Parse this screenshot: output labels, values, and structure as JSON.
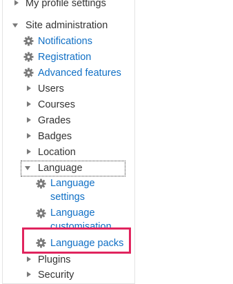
{
  "nav": {
    "my_profile_settings": "My profile settings",
    "site_administration": "Site administration",
    "notifications": "Notifications",
    "registration": "Registration",
    "advanced_features": "Advanced features",
    "users": "Users",
    "courses": "Courses",
    "grades": "Grades",
    "badges": "Badges",
    "location": "Location",
    "language": "Language",
    "language_settings_line1": "Language",
    "language_settings_line2": "settings",
    "language_customisation_line1": "Language",
    "language_customisation_line2": "customisation",
    "language_packs": "Language packs",
    "plugins": "Plugins",
    "security": "Security"
  },
  "icons": {
    "collapsed": "triangle-right-icon",
    "expanded": "triangle-down-icon",
    "settings": "gear-icon"
  },
  "colors": {
    "link": "#0f6fc5",
    "text": "#333333",
    "highlight": "#e0245e",
    "icon": "#7a7a7a"
  }
}
